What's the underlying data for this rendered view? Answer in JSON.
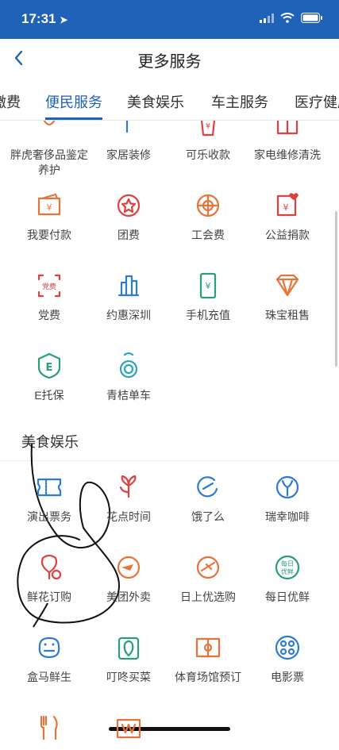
{
  "status": {
    "time": "17:31"
  },
  "nav": {
    "title": "更多服务"
  },
  "tabs": [
    "缴费",
    "便民服务",
    "美食娱乐",
    "车主服务",
    "医疗健康"
  ],
  "section_convenience": [
    {
      "label": "胖虎奢侈品鉴定养护",
      "icon": "brush-icon",
      "color": "#E8743B"
    },
    {
      "label": "家居装修",
      "icon": "paint-roller-icon",
      "color": "#2E7BD6"
    },
    {
      "label": "可乐收款",
      "icon": "cup-yen-icon",
      "color": "#E04040"
    },
    {
      "label": "家电维修清洗",
      "icon": "appliance-icon",
      "color": "#E04040"
    },
    {
      "label": "我要付款",
      "icon": "wallet-yen-icon",
      "color": "#E8743B"
    },
    {
      "label": "团费",
      "icon": "star-badge-icon",
      "color": "#E04040"
    },
    {
      "label": "工会费",
      "icon": "union-icon",
      "color": "#E8743B"
    },
    {
      "label": "公益捐款",
      "icon": "donation-icon",
      "color": "#E04040"
    },
    {
      "label": "党费",
      "icon": "party-fee-icon",
      "color": "#E04040"
    },
    {
      "label": "约惠深圳",
      "icon": "buildings-icon",
      "color": "#2E7BD6"
    },
    {
      "label": "手机充值",
      "icon": "phone-recharge-icon",
      "color": "#2A9D7A"
    },
    {
      "label": "珠宝租售",
      "icon": "jewel-icon",
      "color": "#E8743B"
    },
    {
      "label": "E托保",
      "icon": "shield-e-icon",
      "color": "#2A9D7A"
    },
    {
      "label": "青桔单车",
      "icon": "bike-lock-icon",
      "color": "#2AA7B8"
    }
  ],
  "section_food": {
    "title": "美食娱乐",
    "items": [
      {
        "label": "演出票务",
        "icon": "ticket-icon",
        "color": "#2E7BD6"
      },
      {
        "label": "花点时间",
        "icon": "flower-icon",
        "color": "#E04040"
      },
      {
        "label": "饿了么",
        "icon": "eleme-icon",
        "color": "#2E7BD6"
      },
      {
        "label": "瑞幸咖啡",
        "icon": "deer-icon",
        "color": "#2E7BD6"
      },
      {
        "label": "鲜花订购",
        "icon": "flower-order-icon",
        "color": "#E04040"
      },
      {
        "label": "美团外卖",
        "icon": "delivery-icon",
        "color": "#E8743B"
      },
      {
        "label": "日上优选购",
        "icon": "plane-icon",
        "color": "#E8743B"
      },
      {
        "label": "每日优鲜",
        "icon": "fresh-badge-icon",
        "color": "#2A9D7A"
      },
      {
        "label": "盒马鲜生",
        "icon": "hippo-icon",
        "color": "#2E7BD6"
      },
      {
        "label": "叮咚买菜",
        "icon": "vegetable-icon",
        "color": "#2A9D7A"
      },
      {
        "label": "体育场馆预订",
        "icon": "court-icon",
        "color": "#E8743B"
      },
      {
        "label": "电影票",
        "icon": "film-reel-icon",
        "color": "#2E7BD6"
      },
      {
        "label": "",
        "icon": "fork-knife-icon",
        "color": "#E8743B"
      },
      {
        "label": "",
        "icon": "mall-icon",
        "color": "#E8743B"
      }
    ]
  },
  "annotation": {
    "fresh_badge_text": "每日\n优鲜",
    "party_text": "党费"
  }
}
